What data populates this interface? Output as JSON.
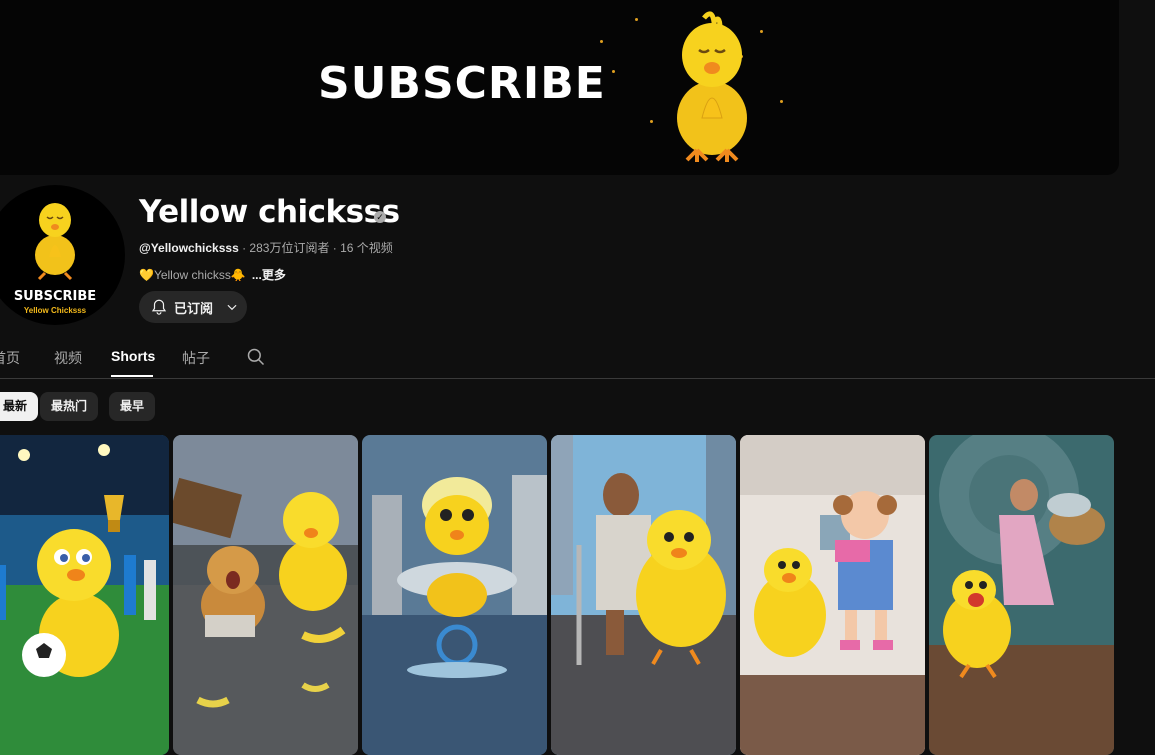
{
  "banner": {
    "text": "SUBSCRIBE"
  },
  "avatar": {
    "line1": "SUBSCRIBE",
    "line2": "Yellow Chicksss"
  },
  "channel": {
    "name": "Yellow chicksss",
    "handle": "@Yellowchicksss",
    "stats": " · 283万位订阅者 · 16 个视频",
    "description": "💛Yellow chickss🐥",
    "more": "...更多",
    "subscribe_label": "已订阅"
  },
  "tabs": [
    {
      "label": "首页",
      "active": false
    },
    {
      "label": "视频",
      "active": false
    },
    {
      "label": "Shorts",
      "active": true
    },
    {
      "label": "帖子",
      "active": false
    }
  ],
  "chips": [
    {
      "label": "最新",
      "active": true
    },
    {
      "label": "最热门",
      "active": false
    },
    {
      "label": "最早",
      "active": false
    }
  ],
  "shorts": [
    {
      "scene": "football-stadium-trophy"
    },
    {
      "scene": "puppy-crying-bananas"
    },
    {
      "scene": "rain-unicycle-fish"
    },
    {
      "scene": "old-man-crutch-city"
    },
    {
      "scene": "girl-camera-room"
    },
    {
      "scene": "storm-grandma-fish-basket"
    }
  ],
  "icons": {
    "bell": "bell-icon",
    "chevron": "chevron-down-icon",
    "search": "search-icon",
    "verified": "verified-icon"
  },
  "colors": {
    "background": "#0f0f0f",
    "chip_bg": "#272727",
    "chick_yellow": "#f7d21e"
  }
}
